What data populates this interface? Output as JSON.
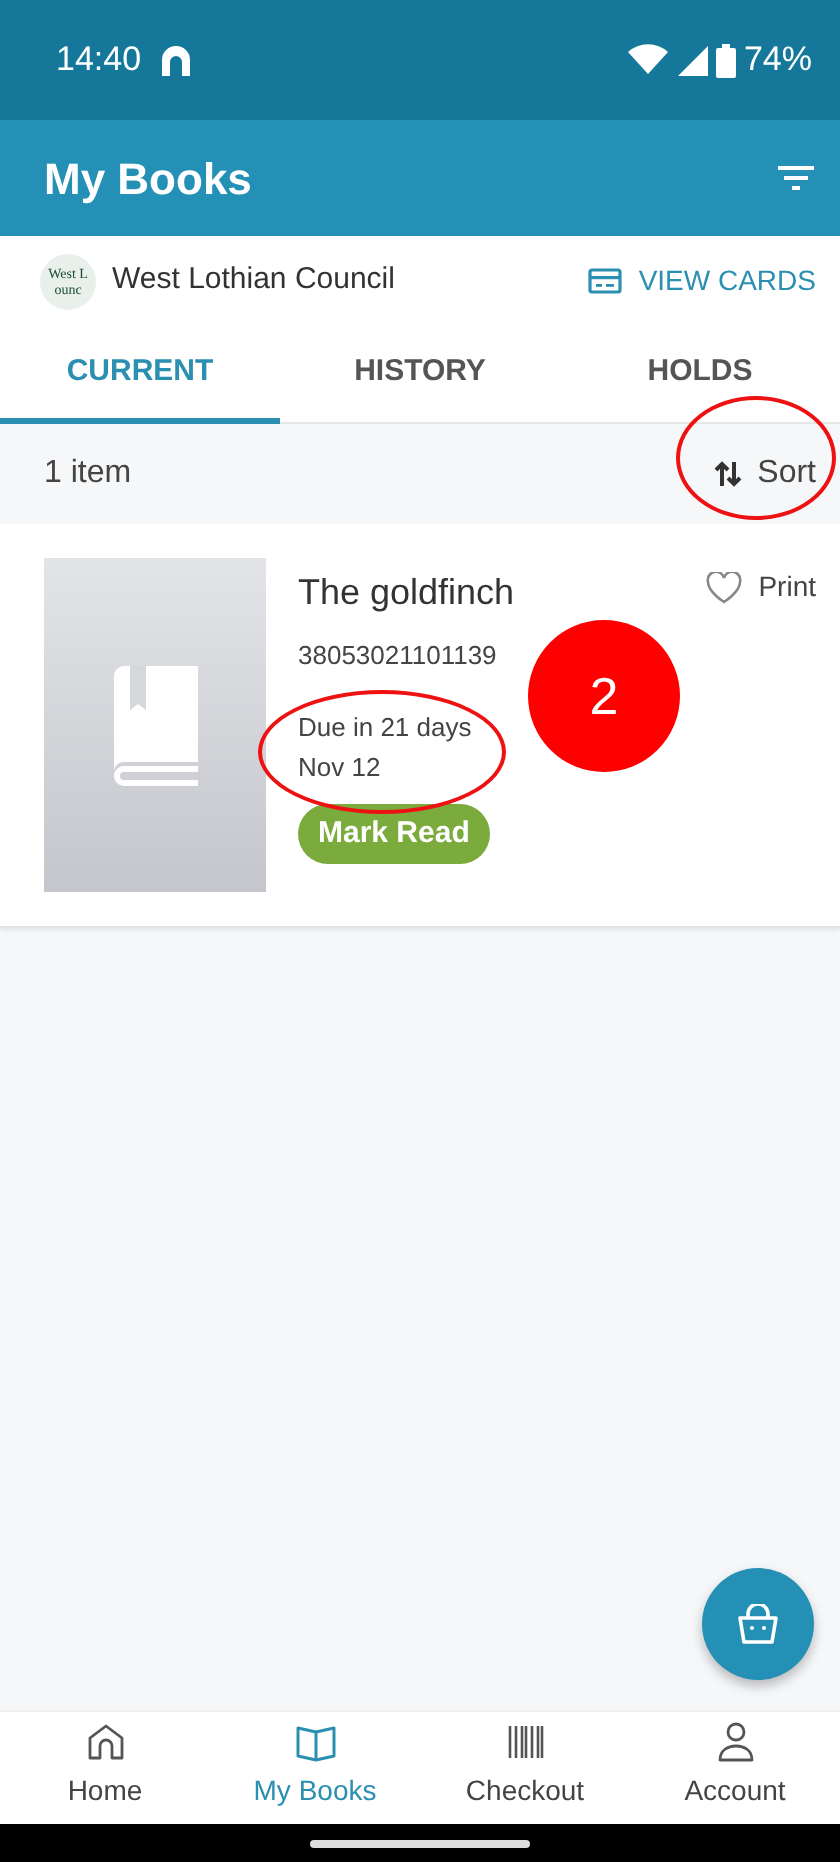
{
  "status_bar": {
    "time": "14:40",
    "battery": "74%"
  },
  "app_bar": {
    "title": "My Books"
  },
  "library": {
    "logo_text": [
      "West L",
      "ounc"
    ],
    "name": "West Lothian Council",
    "action": "VIEW CARDS"
  },
  "tabs": [
    {
      "label": "CURRENT",
      "selected": true
    },
    {
      "label": "HISTORY",
      "selected": false
    },
    {
      "label": "HOLDS",
      "selected": false
    }
  ],
  "list_header": {
    "count": "1 item",
    "sort": {
      "label": "Sort",
      "circled": true
    }
  },
  "items": [
    {
      "title": "The goldfinch",
      "barcode": "38053021101139",
      "due": {
        "lines": [
          "Due in 21 days",
          "Nov 12"
        ],
        "circled": true
      },
      "favorite": false,
      "print": "Print",
      "mark_read": "Mark Read",
      "callout": "2"
    }
  ],
  "bottom_nav": [
    {
      "label": "Home",
      "kind": "home",
      "selected": false
    },
    {
      "label": "My Books",
      "kind": "book",
      "selected": true
    },
    {
      "label": "Checkout",
      "kind": "barcode",
      "selected": false
    },
    {
      "label": "Account",
      "kind": "person",
      "selected": false
    }
  ]
}
